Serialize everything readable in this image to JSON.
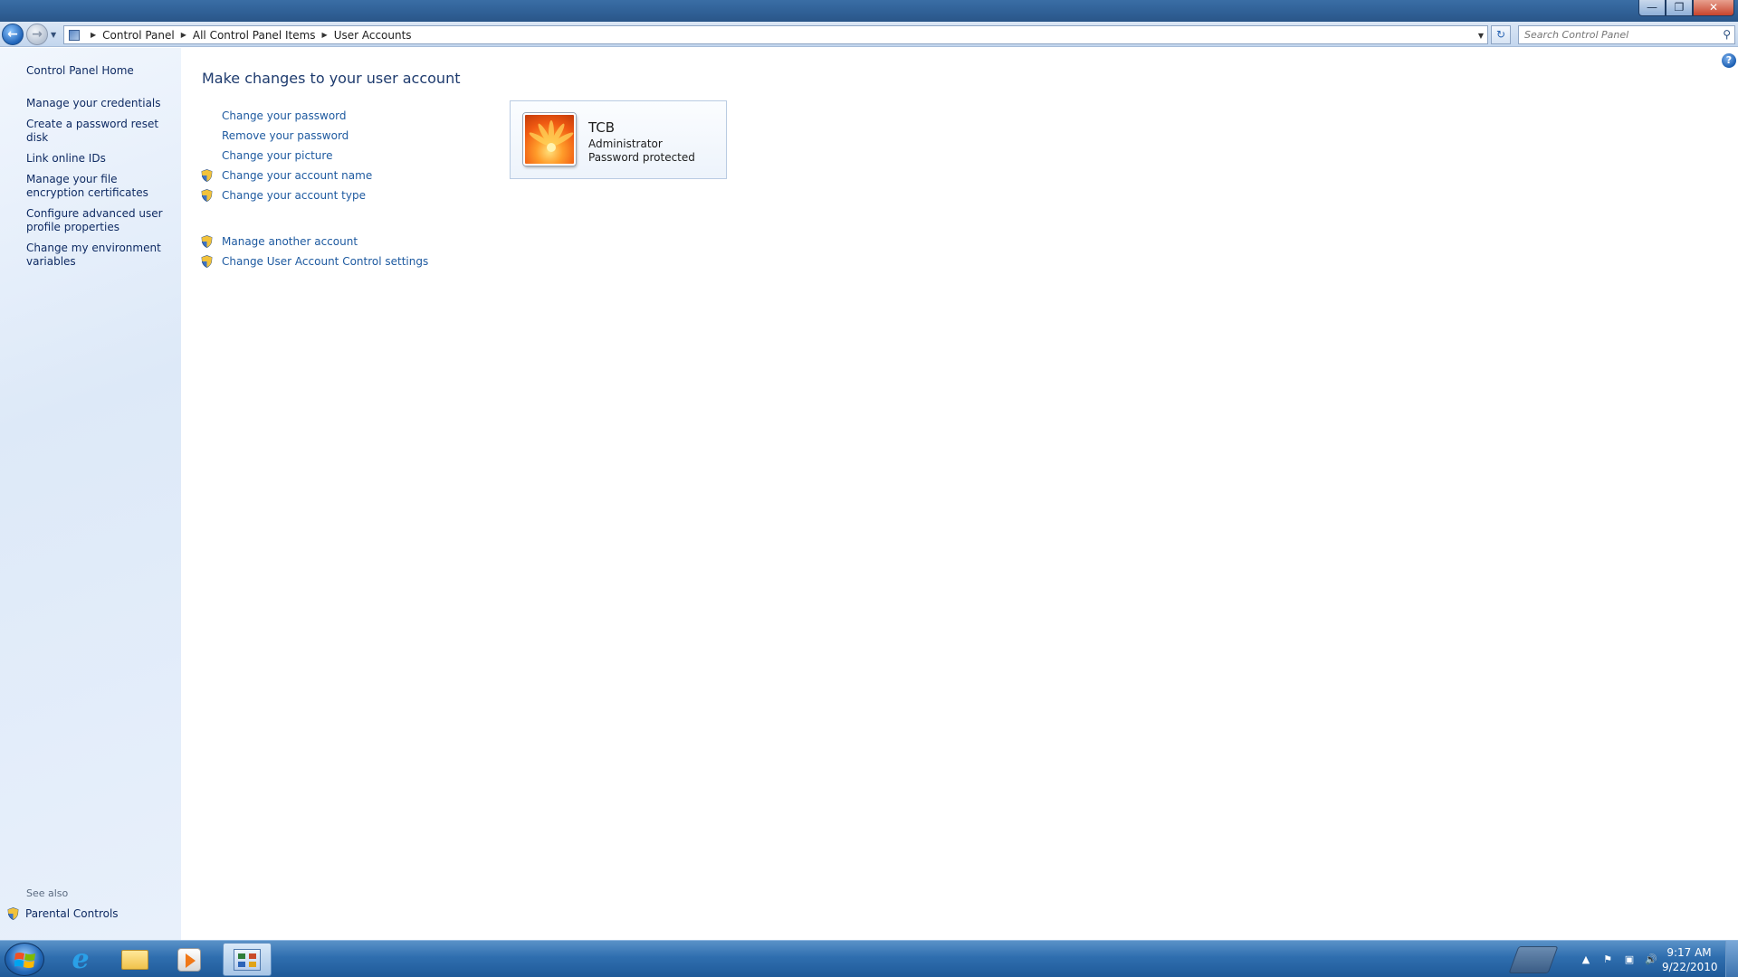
{
  "window": {
    "minimize_label": "—",
    "maximize_label": "❐",
    "close_label": "✕"
  },
  "navigation": {
    "back_icon": "arrow-left-icon",
    "forward_icon": "arrow-right-icon",
    "breadcrumb": [
      "Control Panel",
      "All Control Panel Items",
      "User Accounts"
    ],
    "search_placeholder": "Search Control Panel"
  },
  "left_pane": {
    "home_label": "Control Panel Home",
    "links": [
      "Manage your credentials",
      "Create a password reset disk",
      "Link online IDs",
      "Manage your file encryption certificates",
      "Configure advanced user profile properties",
      "Change my environment variables"
    ],
    "see_also_label": "See also",
    "parental_controls_label": "Parental Controls"
  },
  "main": {
    "title": "Make changes to your user account",
    "tasks": [
      {
        "label": "Change your password",
        "shield": false
      },
      {
        "label": "Remove your password",
        "shield": false
      },
      {
        "label": "Change your picture",
        "shield": false
      },
      {
        "label": "Change your account name",
        "shield": true
      },
      {
        "label": "Change your account type",
        "shield": true
      }
    ],
    "other_tasks": [
      {
        "label": "Manage another account",
        "shield": true
      },
      {
        "label": "Change User Account Control settings",
        "shield": true
      }
    ],
    "help_label": "?"
  },
  "account": {
    "name": "TCB",
    "type": "Administrator",
    "status": "Password protected"
  },
  "taskbar": {
    "time": "9:17 AM",
    "date": "9/22/2010",
    "ie_glyph": "e",
    "tray_up_glyph": "▲",
    "tray_flag_glyph": "⚑",
    "tray_network_glyph": "▣",
    "tray_volume_glyph": "🔊"
  },
  "colors": {
    "link": "#1e5aa0",
    "nav_link": "#0f2b63",
    "title": "#1e3b6e",
    "taskbar": "#2f6eaf"
  }
}
